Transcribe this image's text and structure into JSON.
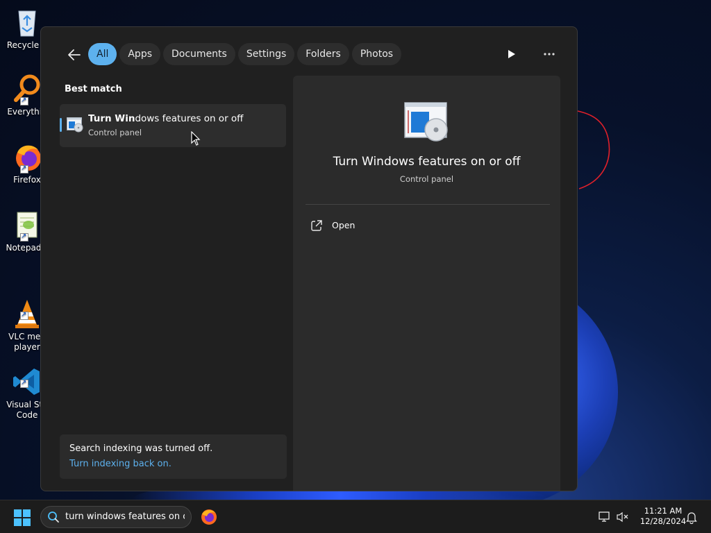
{
  "desktop": {
    "icons": [
      {
        "label": "Recycle B",
        "name": "recycle-bin-icon"
      },
      {
        "label": "Everythin",
        "name": "everything-icon"
      },
      {
        "label": "Firefox",
        "name": "firefox-icon"
      },
      {
        "label": "Notepad+",
        "name": "notepad-plus-plus-icon"
      },
      {
        "label": "VLC med\nplayer",
        "name": "vlc-icon"
      },
      {
        "label": "Visual Stu\nCode",
        "name": "vscode-icon"
      }
    ]
  },
  "search_panel": {
    "filters": [
      "All",
      "Apps",
      "Documents",
      "Settings",
      "Folders",
      "Photos"
    ],
    "active_filter": "All",
    "best_match_heading": "Best match",
    "result": {
      "title_bold": "Turn Win",
      "title_rest": "dows features on or off",
      "subtitle": "Control panel"
    },
    "detail": {
      "title": "Turn Windows features on or off",
      "subtitle": "Control panel",
      "actions": [
        {
          "label": "Open",
          "icon": "open-external-icon"
        }
      ]
    },
    "notice": {
      "message": "Search indexing was turned off.",
      "link": "Turn indexing back on."
    }
  },
  "taskbar": {
    "search_text": "turn windows features on c",
    "time": "11:21 AM",
    "date": "12/28/2024"
  },
  "colors": {
    "accent": "#5db1ee",
    "panel_bg": "#202020",
    "detail_bg": "#2b2b2b"
  }
}
